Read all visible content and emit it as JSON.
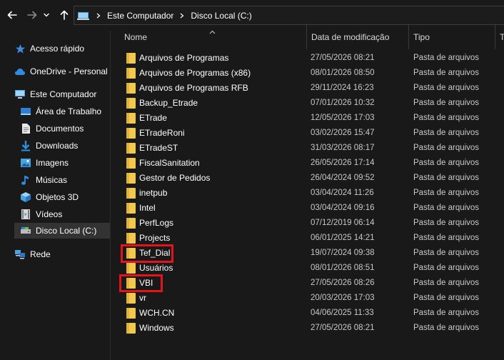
{
  "address": {
    "crumbs": [
      "Este Computador",
      "Disco Local (C:)"
    ]
  },
  "columns": {
    "name": "Nome",
    "date": "Data de modificação",
    "type": "Tipo",
    "size": "Ta"
  },
  "nav": [
    {
      "label": "Acesso rápido",
      "icon": "star-icon"
    },
    {
      "label": "OneDrive - Personal",
      "icon": "cloud-icon"
    },
    {
      "label": "Este Computador",
      "icon": "computer-icon"
    },
    {
      "label": "Área de Trabalho",
      "icon": "desktop-icon"
    },
    {
      "label": "Documentos",
      "icon": "document-icon"
    },
    {
      "label": "Downloads",
      "icon": "download-icon"
    },
    {
      "label": "Imagens",
      "icon": "image-icon"
    },
    {
      "label": "Músicas",
      "icon": "music-icon"
    },
    {
      "label": "Objetos 3D",
      "icon": "cube-icon"
    },
    {
      "label": "Vídeos",
      "icon": "video-icon"
    },
    {
      "label": "Disco Local (C:)",
      "icon": "drive-icon"
    },
    {
      "label": "Rede",
      "icon": "network-icon"
    }
  ],
  "files": [
    {
      "name": "Arquivos de Programas",
      "date": "27/05/2026 08:21",
      "type": "Pasta de arquivos"
    },
    {
      "name": "Arquivos de Programas (x86)",
      "date": "08/01/2026 08:50",
      "type": "Pasta de arquivos"
    },
    {
      "name": "Arquivos de Programas RFB",
      "date": "29/11/2024 16:23",
      "type": "Pasta de arquivos"
    },
    {
      "name": "Backup_Etrade",
      "date": "07/01/2026 10:32",
      "type": "Pasta de arquivos"
    },
    {
      "name": "ETrade",
      "date": "12/05/2026 17:03",
      "type": "Pasta de arquivos"
    },
    {
      "name": "ETradeRoni",
      "date": "03/02/2026 15:47",
      "type": "Pasta de arquivos"
    },
    {
      "name": "ETradeST",
      "date": "31/03/2026 08:17",
      "type": "Pasta de arquivos"
    },
    {
      "name": "FiscalSanitation",
      "date": "26/05/2026 17:14",
      "type": "Pasta de arquivos"
    },
    {
      "name": "Gestor de Pedidos",
      "date": "26/04/2024 09:52",
      "type": "Pasta de arquivos"
    },
    {
      "name": "inetpub",
      "date": "03/04/2024 11:26",
      "type": "Pasta de arquivos"
    },
    {
      "name": "Intel",
      "date": "03/04/2024 09:16",
      "type": "Pasta de arquivos"
    },
    {
      "name": "PerfLogs",
      "date": "07/12/2019 06:14",
      "type": "Pasta de arquivos"
    },
    {
      "name": "Projects",
      "date": "06/01/2025 14:21",
      "type": "Pasta de arquivos"
    },
    {
      "name": "Tef_Dial",
      "date": "19/07/2024 09:38",
      "type": "Pasta de arquivos"
    },
    {
      "name": "Usuários",
      "date": "08/01/2026 08:51",
      "type": "Pasta de arquivos"
    },
    {
      "name": "VBI",
      "date": "27/05/2026 08:26",
      "type": "Pasta de arquivos"
    },
    {
      "name": "vr",
      "date": "20/03/2026 17:03",
      "type": "Pasta de arquivos"
    },
    {
      "name": "WCH.CN",
      "date": "04/06/2025 11:33",
      "type": "Pasta de arquivos"
    },
    {
      "name": "Windows",
      "date": "27/05/2026 08:21",
      "type": "Pasta de arquivos"
    }
  ],
  "colors": {
    "background": "#191919",
    "folder": "#f2c94c",
    "highlight": "#e3141b",
    "selected": "#333333"
  }
}
